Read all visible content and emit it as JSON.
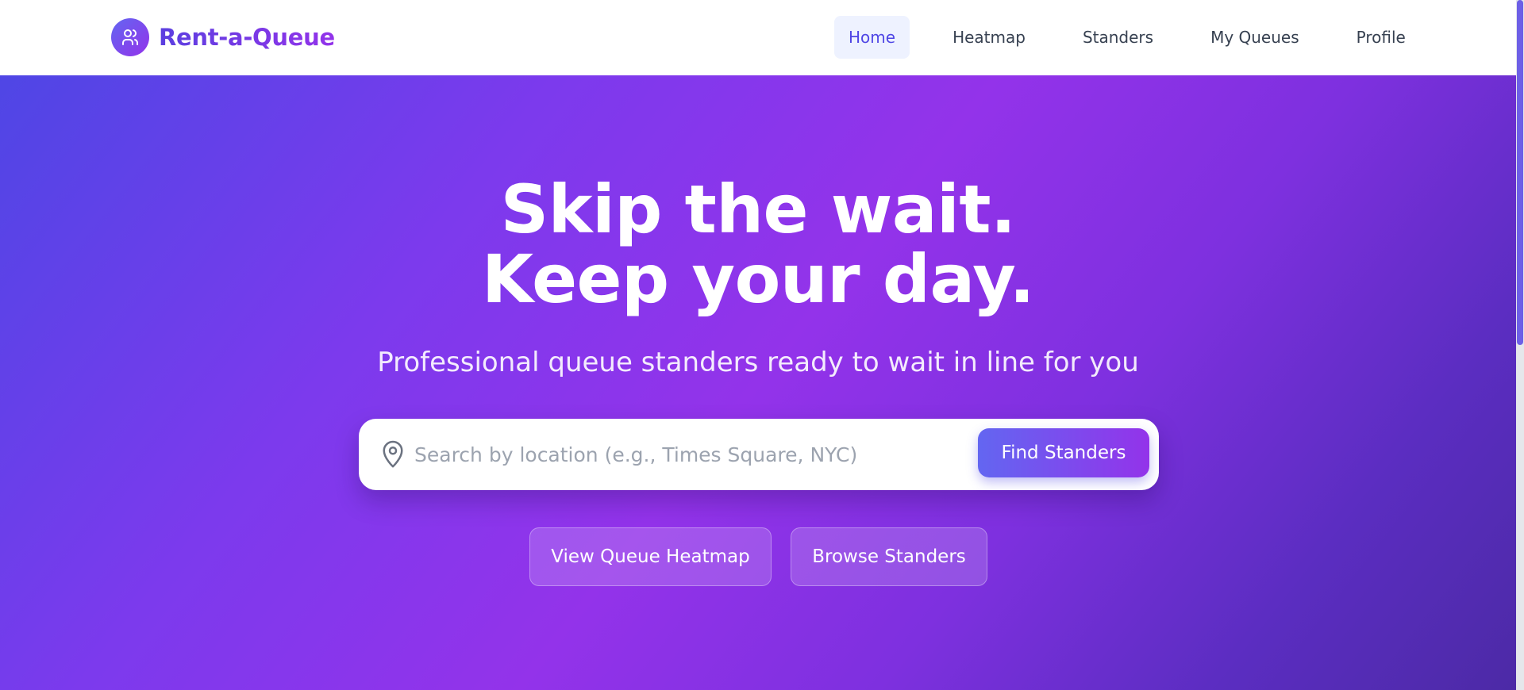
{
  "brand": {
    "name": "Rent-a-Queue",
    "logo_icon": "users-icon"
  },
  "nav": {
    "items": [
      {
        "label": "Home",
        "active": true
      },
      {
        "label": "Heatmap",
        "active": false
      },
      {
        "label": "Standers",
        "active": false
      },
      {
        "label": "My Queues",
        "active": false
      },
      {
        "label": "Profile",
        "active": false
      }
    ]
  },
  "hero": {
    "title_line1": "Skip the wait.",
    "title_line2": "Keep your day.",
    "subtitle": "Professional queue standers ready to wait in line for you",
    "search": {
      "icon": "map-pin-icon",
      "placeholder": "Search by location (e.g., Times Square, NYC)",
      "value": "",
      "button_label": "Find Standers"
    },
    "actions": {
      "heatmap_label": "View Queue Heatmap",
      "browse_label": "Browse Standers"
    }
  },
  "colors": {
    "accent": "#4f46e5",
    "brand_purple": "#9333ea",
    "nav_active_bg": "#eef2ff",
    "nav_text": "#374151"
  }
}
